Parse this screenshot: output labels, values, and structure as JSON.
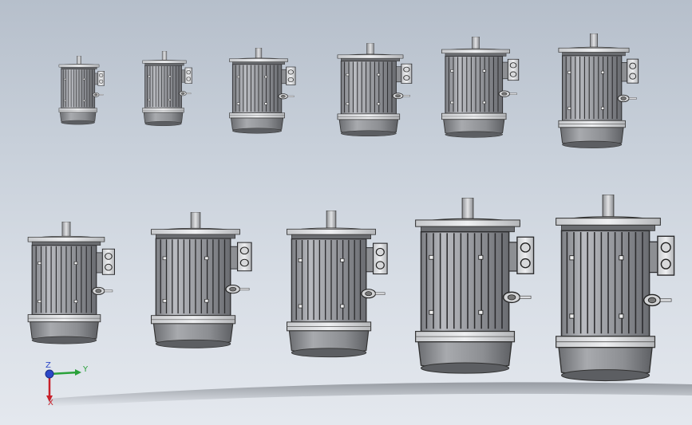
{
  "scene": {
    "description_free": true,
    "motor_count": 11,
    "background_top": "#b6bfcb",
    "background_bottom": "#e4e8ee"
  },
  "triad": {
    "x_label": "X",
    "y_label": "Y",
    "z_label": "Z",
    "x_color": "#c8202a",
    "y_color": "#2aa13a",
    "z_color": "#2c47c8"
  }
}
